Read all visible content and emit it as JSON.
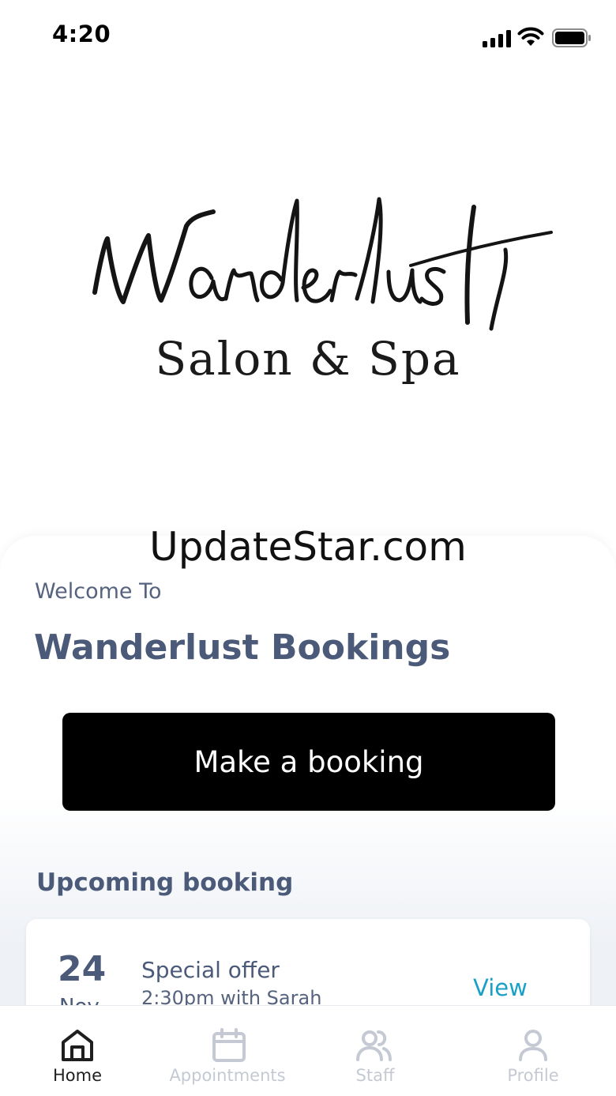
{
  "status_bar": {
    "time": "4:20"
  },
  "logo": {
    "script_text": "Wanderlust",
    "subtitle": "Salon & Spa"
  },
  "watermark": "UpdateStar.com",
  "welcome": {
    "label": "Welcome To",
    "title": "Wanderlust Bookings"
  },
  "booking_button": {
    "label": "Make a booking"
  },
  "upcoming": {
    "section_title": "Upcoming booking",
    "card": {
      "day": "24",
      "month": "Nov",
      "title": "Special offer",
      "subtitle": "2:30pm with Sarah",
      "action": "View"
    }
  },
  "tabs": [
    {
      "label": "Home",
      "icon": "home-icon",
      "active": true
    },
    {
      "label": "Appointments",
      "icon": "calendar-icon",
      "active": false
    },
    {
      "label": "Staff",
      "icon": "people-icon",
      "active": false
    },
    {
      "label": "Profile",
      "icon": "person-icon",
      "active": false
    }
  ],
  "colors": {
    "text_primary": "#4a5a78",
    "accent_link": "#1aa0c8",
    "button_bg": "#000000",
    "tab_inactive": "#c4c9d3"
  }
}
